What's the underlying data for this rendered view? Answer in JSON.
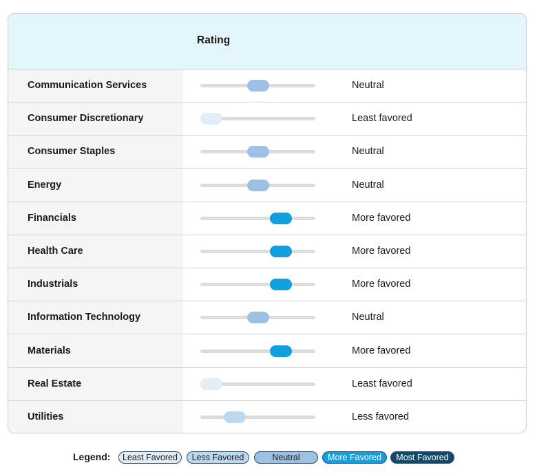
{
  "header": {
    "rating_label": "Rating"
  },
  "rows": [
    {
      "sector": "Communication Services",
      "rating": "Neutral",
      "level": 2
    },
    {
      "sector": "Consumer Discretionary",
      "rating": "Least favored",
      "level": 0
    },
    {
      "sector": "Consumer Staples",
      "rating": "Neutral",
      "level": 2
    },
    {
      "sector": "Energy",
      "rating": "Neutral",
      "level": 2
    },
    {
      "sector": "Financials",
      "rating": "More favored",
      "level": 3
    },
    {
      "sector": "Health Care",
      "rating": "More favored",
      "level": 3
    },
    {
      "sector": "Industrials",
      "rating": "More favored",
      "level": 3
    },
    {
      "sector": "Information Technology",
      "rating": "Neutral",
      "level": 2
    },
    {
      "sector": "Materials",
      "rating": "More favored",
      "level": 3
    },
    {
      "sector": "Real Estate",
      "rating": "Least favored",
      "level": 0
    },
    {
      "sector": "Utilities",
      "rating": "Less favored",
      "level": 1
    }
  ],
  "level_scale": {
    "min": 0,
    "max": 4
  },
  "level_colors": [
    "#e1eef8",
    "#bcd8ef",
    "#9dc0e4",
    "#129fe0",
    "#0d4a6e"
  ],
  "legend": {
    "title": "Legend:",
    "items": [
      {
        "label": "Least Favored",
        "color": "#e1eef8",
        "text_color": "#1a1a1a"
      },
      {
        "label": "Less Favored",
        "color": "#bcd8ef",
        "text_color": "#1a1a1a"
      },
      {
        "label": "Neutral",
        "color": "#9dc0e4",
        "text_color": "#1a1a1a"
      },
      {
        "label": "More Favored",
        "color": "#129fe0",
        "text_color": "#ffffff"
      },
      {
        "label": "Most Favored",
        "color": "#0d4a6e",
        "text_color": "#ffffff"
      }
    ]
  }
}
